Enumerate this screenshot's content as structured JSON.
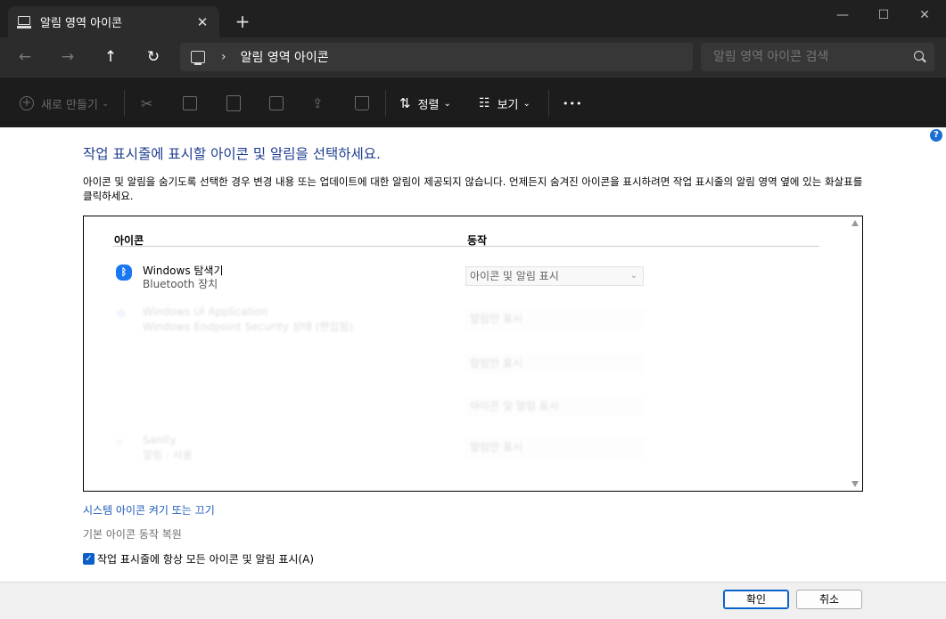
{
  "window": {
    "tab_title": "알림 영역 아이콘",
    "tab_close": "✕",
    "new_tab": "+",
    "minimize": "—",
    "maximize": "☐",
    "close": "✕"
  },
  "nav": {
    "back": "←",
    "forward": "→",
    "up": "↑",
    "refresh": "↻",
    "chevron": "›",
    "breadcrumb": "알림 영역 아이콘",
    "search_placeholder": "알림 영역 아이콘 검색"
  },
  "toolbar": {
    "new_label": "새로 만들기",
    "sort_label": "정렬",
    "view_label": "보기",
    "more": "•••",
    "caret": "⌄"
  },
  "content": {
    "heading": "작업 표시줄에 표시할 아이콘 및 알림을 선택하세요.",
    "description": "아이콘 및 알림을 숨기도록 선택한 경우 변경 내용 또는 업데이트에 대한 알림이 제공되지 않습니다. 언제든지 숨겨진 아이콘을 표시하려면 작업 표시줄의 알림 영역 옆에 있는 화살표를 클릭하세요.",
    "col_icon": "아이콘",
    "col_behavior": "동작",
    "rows": [
      {
        "name": "Windows 탐색기",
        "sub": "Bluetooth 장치",
        "behavior": "아이콘 및 알림 표시"
      },
      {
        "name": "Windows UI Application",
        "sub": "Windows Endpoint Security 상태 (편집됨)",
        "behavior": "알림만 표시"
      },
      {
        "name": "",
        "sub": "",
        "behavior": "알림만 표시"
      },
      {
        "name": "",
        "sub": "",
        "behavior": "아이콘 및 알림 표시"
      },
      {
        "name": "Sanity",
        "sub": "알림 : 사용",
        "behavior": "알림만 표시"
      }
    ],
    "link": "시스템 아이콘 켜기 또는 끄기",
    "restore": "기본 아이콘 동작 복원",
    "checkbox_label": "작업 표시줄에 항상 모든 아이콘 및 알림 표시(A)",
    "check_mark": "✓",
    "help": "?"
  },
  "footer": {
    "ok": "확인",
    "cancel": "취소"
  }
}
